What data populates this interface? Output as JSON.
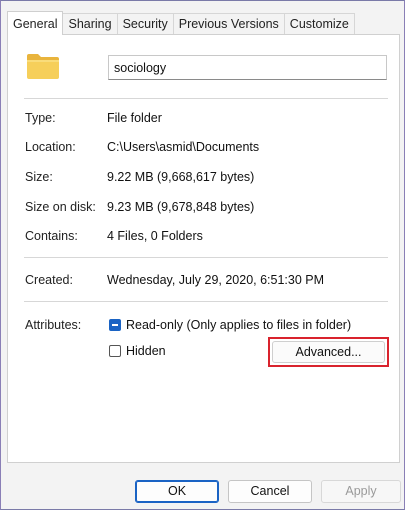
{
  "tabs": [
    {
      "label": "General",
      "active": true
    },
    {
      "label": "Sharing",
      "active": false
    },
    {
      "label": "Security",
      "active": false
    },
    {
      "label": "Previous Versions",
      "active": false
    },
    {
      "label": "Customize",
      "active": false
    }
  ],
  "folder": {
    "icon": "folder-icon",
    "name": "sociology"
  },
  "properties": {
    "type_label": "Type:",
    "type_value": "File folder",
    "location_label": "Location:",
    "location_value": "C:\\Users\\asmid\\Documents",
    "size_label": "Size:",
    "size_value": "9.22 MB (9,668,617 bytes)",
    "size_on_disk_label": "Size on disk:",
    "size_on_disk_value": "9.23 MB (9,678,848 bytes)",
    "contains_label": "Contains:",
    "contains_value": "4 Files, 0 Folders",
    "created_label": "Created:",
    "created_value": "Wednesday, July 29, 2020, 6:51:30 PM"
  },
  "attributes": {
    "label": "Attributes:",
    "readonly_label": "Read-only (Only applies to files in folder)",
    "readonly_state": "indeterminate",
    "hidden_label": "Hidden",
    "hidden_checked": false,
    "advanced_label": "Advanced..."
  },
  "buttons": {
    "ok": "OK",
    "cancel": "Cancel",
    "apply": "Apply",
    "apply_enabled": false
  },
  "colors": {
    "accent": "#1a63c4",
    "highlight": "#d9232d",
    "folder": "#f2c94c"
  }
}
